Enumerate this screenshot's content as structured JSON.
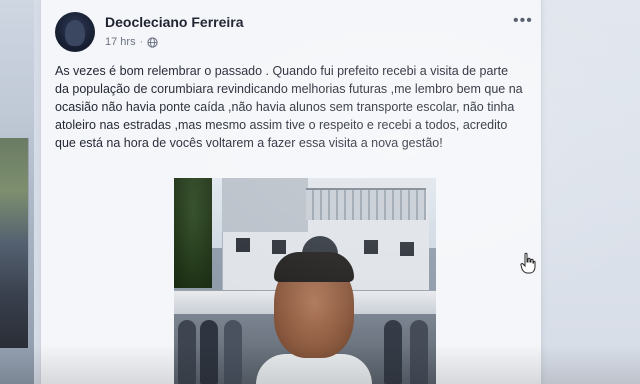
{
  "post": {
    "author": "Deocleciano Ferreira",
    "time": "17 hrs",
    "separator": "·",
    "privacy_icon": "globe-icon",
    "more_icon": "more-options-icon",
    "more_glyph": "•••",
    "text": "As vezes é bom relembrar o passado . Quando fui prefeito recebi a visita de parte da população de corumbiara revindicando melhorias futuras ,me lembro bem que na ocasião não havia ponte caída ,não havia alunos sem transporte escolar, não tinha atoleiro nas estradas ,mas mesmo assim tive o respeito e recebi a todos, acredito que está na hora de vocês voltarem a fazer essa visita a nova gestão!"
  },
  "colors": {
    "author_text": "#1f2330",
    "meta_text": "#6b7280",
    "body_text": "#242834",
    "card_bg": "#f4f6f9"
  },
  "cursor": {
    "icon": "hand-pointer-icon"
  }
}
